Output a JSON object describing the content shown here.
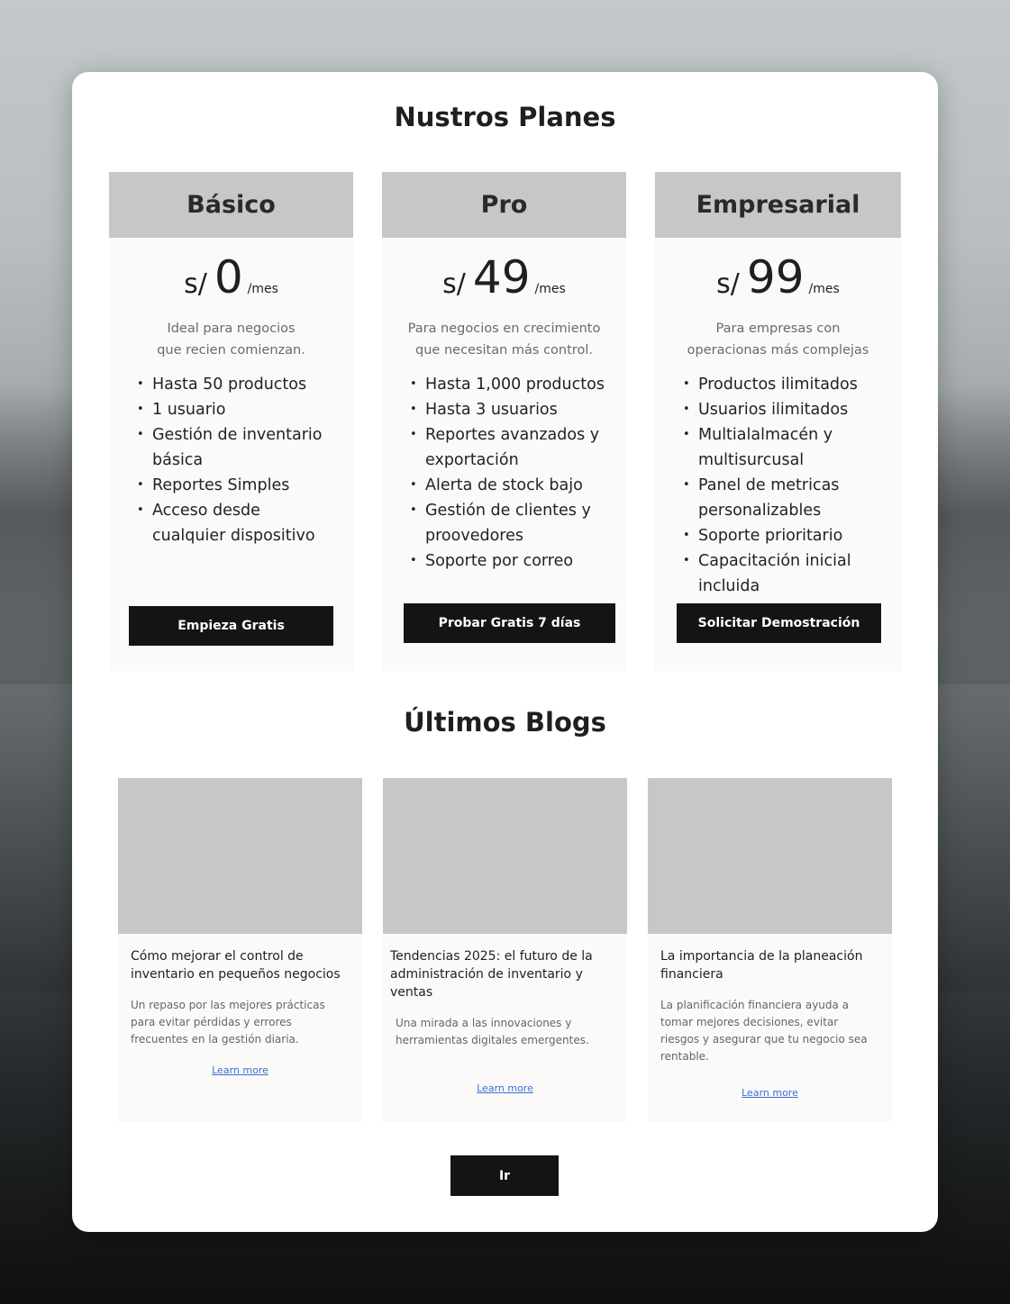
{
  "plans_section": {
    "title": "Nustros Planes",
    "plans": [
      {
        "name": "Básico",
        "currency": "s/",
        "price": "0",
        "period": "/mes",
        "description_lines": [
          "Ideal para negocios",
          "que recien comienzan."
        ],
        "features": [
          "Hasta 50 productos",
          "1 usuario",
          "Gestión de inventario básica",
          "Reportes Simples",
          "Acceso desde cualquier dispositivo"
        ],
        "button": "Empieza Gratis"
      },
      {
        "name": "Pro",
        "currency": "s/",
        "price": "49",
        "period": "/mes",
        "description_lines": [
          "Para negocios en crecimiento",
          "que necesitan más control."
        ],
        "features": [
          "Hasta 1,000 productos",
          "Hasta 3 usuarios",
          "Reportes avanzados y exportación",
          "Alerta de stock bajo",
          "Gestión de clientes y proovedores",
          "Soporte por correo"
        ],
        "button": "Probar Gratis 7 días"
      },
      {
        "name": "Empresarial",
        "currency": "s/",
        "price": "99",
        "period": "/mes",
        "description_lines": [
          "Para empresas con",
          "operacionas más complejas"
        ],
        "features": [
          "Productos ilimitados",
          "Usuarios ilimitados",
          "Multialalmacén y multisurcusal",
          "Panel de metricas personalizables",
          "Soporte prioritario",
          "Capacitación inicial incluida"
        ],
        "button": "Solicitar Demostración"
      }
    ]
  },
  "blogs_section": {
    "title": "Últimos Blogs",
    "posts": [
      {
        "title": "Cómo mejorar el control de inventario en pequeños negocios",
        "excerpt": "Un repaso por las mejores prácticas para evitar pérdidas y errores frecuentes en la gestión diaria.",
        "link": "Learn more"
      },
      {
        "title": "Tendencias 2025: el futuro de la administración de inventario y ventas",
        "excerpt": "Una mirada a las innovaciones y herramientas digitales emergentes.",
        "link": "Learn more"
      },
      {
        "title": "La importancia de la planeación financiera",
        "excerpt": "La planificación financiera ayuda a tomar mejores decisiones, evitar riesgos y asegurar que tu negocio sea rentable.",
        "link": "Learn more"
      }
    ],
    "button": "Ir"
  }
}
